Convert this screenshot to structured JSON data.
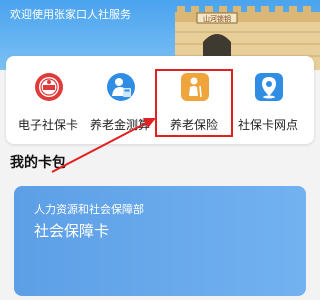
{
  "banner": {
    "welcome_text": "欢迎使用张家口人社服务",
    "gate_plaque": "山河锁钥"
  },
  "services": [
    {
      "label": "电子社保卡",
      "icon": "social-security-badge-icon"
    },
    {
      "label": "养老金测算",
      "icon": "pension-calculator-icon"
    },
    {
      "label": "养老保险",
      "icon": "elderly-person-icon"
    },
    {
      "label": "社保卡网点",
      "icon": "location-pin-icon"
    }
  ],
  "wallet": {
    "section_title": "我的卡包",
    "card_issuer": "人力资源和社会保障部",
    "card_name": "社会保障卡"
  },
  "colors": {
    "annotation_red": "#e12020",
    "card_blue": "#5d9fe6",
    "banner_blue": "#4aa3ee"
  }
}
